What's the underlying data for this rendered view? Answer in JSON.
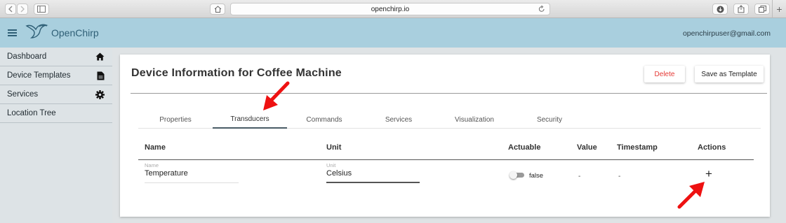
{
  "browser": {
    "url": "openchirp.io"
  },
  "header": {
    "brand": "OpenChirp",
    "user_email": "openchirpuser@gmail.com"
  },
  "sidebar": {
    "items": [
      {
        "label": "Dashboard",
        "icon": "home-icon"
      },
      {
        "label": "Device Templates",
        "icon": "document-icon"
      },
      {
        "label": "Services",
        "icon": "gear-icon"
      },
      {
        "label": "Location Tree",
        "icon": ""
      }
    ]
  },
  "card": {
    "title": "Device Information for Coffee Machine",
    "delete_label": "Delete",
    "save_template_label": "Save as Template"
  },
  "tabs": [
    {
      "label": "Properties",
      "active": false
    },
    {
      "label": "Transducers",
      "active": true
    },
    {
      "label": "Commands",
      "active": false
    },
    {
      "label": "Services",
      "active": false
    },
    {
      "label": "Visualization",
      "active": false
    },
    {
      "label": "Security",
      "active": false
    }
  ],
  "table": {
    "columns": [
      "Name",
      "Unit",
      "Actuable",
      "Value",
      "Timestamp",
      "Actions"
    ],
    "new_row": {
      "name_label": "Name",
      "name_value": "Temperature",
      "unit_label": "Unit",
      "unit_value": "Celsius",
      "actuable_text": "false",
      "actuable_on": false,
      "value": "-",
      "timestamp": "-",
      "action_symbol": "+"
    }
  },
  "colors": {
    "header_bg": "#a9cfde",
    "brand_color": "#2f5f76",
    "sidebar_bg": "#dde3e6",
    "delete_text": "#e53935",
    "annotation_arrow": "#ee1111"
  }
}
